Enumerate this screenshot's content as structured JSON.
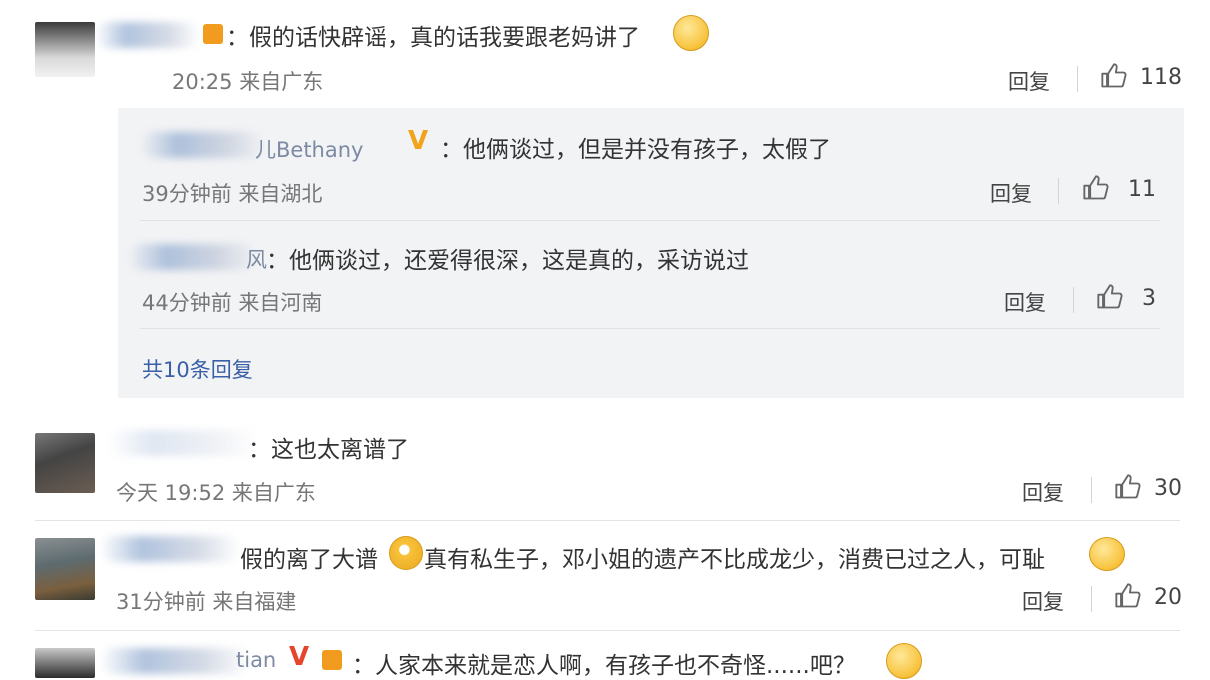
{
  "comments": [
    {
      "text": "：假的话快辟谣，真的话我要跟老妈讲了",
      "meta": "20:25 来自广东",
      "reply_label": "回复",
      "likes": "118"
    },
    {
      "text": "：这也太离谱了",
      "meta": "今天 19:52 来自广东",
      "reply_label": "回复",
      "likes": "30"
    },
    {
      "text": "假的离了大谱",
      "text2": "真有私生子，邓小姐的遗产不比成龙少，消费已过之人，可耻",
      "meta": "31分钟前 来自福建",
      "reply_label": "回复",
      "likes": "20"
    },
    {
      "name_fragment": "tian",
      "text": "：人家本来就是恋人啊，有孩子也不奇怪......吧？"
    }
  ],
  "replies": [
    {
      "name_fragment": "儿Bethany",
      "text": "：他俩谈过，但是并没有孩子，太假了",
      "meta": "39分钟前 来自湖北",
      "reply_label": "回复",
      "likes": "11"
    },
    {
      "name_fragment": "风",
      "text": "：他俩谈过，还爱得很深，这是真的，采访说过",
      "meta": "44分钟前 来自河南",
      "reply_label": "回复",
      "likes": "3"
    }
  ],
  "more_replies": "共10条回复",
  "colors": {
    "link": "#3a5fa7",
    "badge": "#f0a31b",
    "panel": "#f2f3f5"
  },
  "icons": [
    "thumbs-up-icon",
    "vip-badge-icon",
    "verified-v-icon",
    "emoji-icon"
  ]
}
